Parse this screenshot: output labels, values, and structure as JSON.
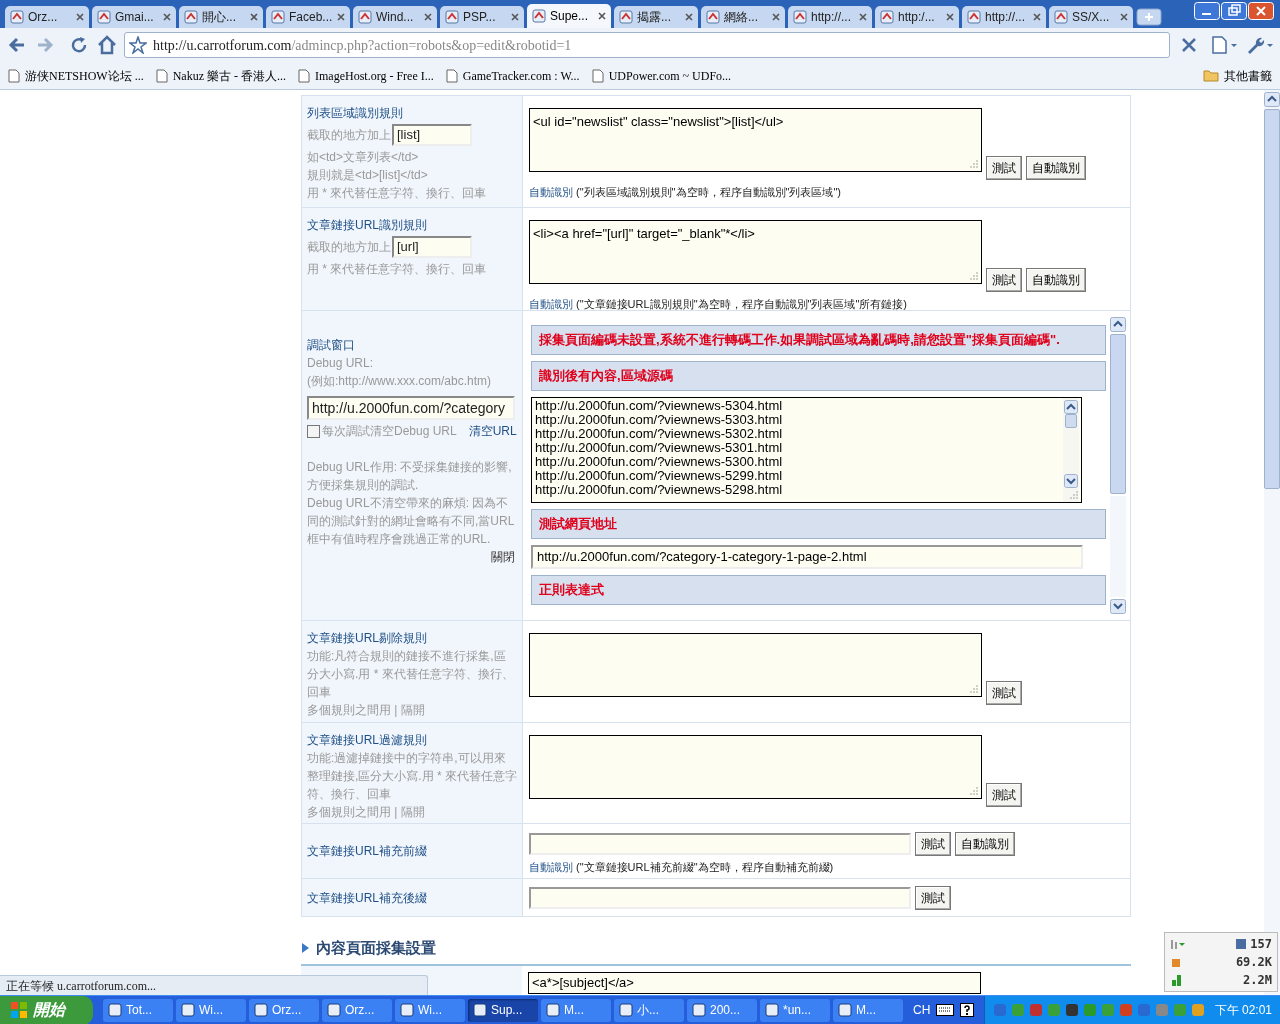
{
  "tabs": [
    {
      "label": "Orz...",
      "selected": false
    },
    {
      "label": "Gmai...",
      "selected": false
    },
    {
      "label": "開心...",
      "selected": false
    },
    {
      "label": "Faceb...",
      "selected": false
    },
    {
      "label": "Wind...",
      "selected": false
    },
    {
      "label": "PSP...",
      "selected": false
    },
    {
      "label": "Supe...",
      "selected": true
    },
    {
      "label": "揭露...",
      "selected": false
    },
    {
      "label": "網絡...",
      "selected": false
    },
    {
      "label": "http://...",
      "selected": false
    },
    {
      "label": "http:/...",
      "selected": false
    },
    {
      "label": "http://...",
      "selected": false
    },
    {
      "label": "SS/X...",
      "selected": false
    }
  ],
  "address": {
    "host": "http://u.carrotforum.com",
    "path": "/admincp.php?action=robots&op=edit&robotid=1"
  },
  "bookmarks": [
    "游侠NETSHOW论坛 ...",
    "Nakuz 樂古 - 香港人...",
    "ImageHost.org - Free I...",
    "GameTracker.com : W...",
    "UDPower.com ~ UDFo..."
  ],
  "other_bookmarks": "其他書籤",
  "rules": [
    {
      "kind": "textarea",
      "title": "列表區域識別規則",
      "capture_label": "截取的地方加上",
      "capture_value": "[list]",
      "hints": [
        "如<td>文章列表</td>",
        "規則就是<td>[list]</td>",
        "用 * 來代替任意字符、換行、回車"
      ],
      "value": "<ul id=\"newslist\" class=\"newslist\">[list]</ul>",
      "buttons": [
        "測試",
        "自動識別"
      ],
      "note_link": "自動識別",
      "note": "(\"列表區域識別規則\"為空時，程序自動識別\"列表區域\")"
    },
    {
      "kind": "textarea",
      "title": "文章鏈接URL識別規則",
      "capture_label": "截取的地方加上",
      "capture_value": "[url]",
      "hints": [
        "用 * 來代替任意字符、換行、回車"
      ],
      "value": "<li><a href=\"[url]\" target=\"_blank\"*</li>",
      "buttons": [
        "測試",
        "自動識別"
      ],
      "note_link": "自動識別",
      "note": "(\"文章鏈接URL識別規則\"為空時，程序自動識別\"列表區域\"所有鏈接)"
    },
    {
      "kind": "debug",
      "title": "調試窗口",
      "hints": [
        "Debug URL:",
        "(例如:http://www.xxx.com/abc.htm)"
      ],
      "debug_url": "http://u.2000fun.com/?category",
      "clear_checkbox": {
        "label": "每次調試清空Debug URL",
        "checked": false
      },
      "clear_link": "清空URL",
      "notes": [
        "Debug URL作用: 不受採集鏈接的影響,方便採集規則的調試.",
        "Debug URL不清空帶來的麻煩: 因為不同的測試針對的網址會略有不同,當URL框中有值時程序會跳過正常的URL."
      ],
      "close_link": "關閉",
      "panel": [
        {
          "kind": "heading",
          "text": "採集頁面編碼未設置,系統不進行轉碼工作.如果調試區域為亂碼時,請您設置\"採集頁面編碼\"."
        },
        {
          "kind": "heading",
          "text": "識別後有內容,區域源碼"
        },
        {
          "kind": "list",
          "lines": [
            "http://u.2000fun.com/?viewnews-5304.html",
            "http://u.2000fun.com/?viewnews-5303.html",
            "http://u.2000fun.com/?viewnews-5302.html",
            "http://u.2000fun.com/?viewnews-5301.html",
            "http://u.2000fun.com/?viewnews-5300.html",
            "http://u.2000fun.com/?viewnews-5299.html",
            "http://u.2000fun.com/?viewnews-5298.html"
          ]
        },
        {
          "kind": "heading",
          "text": "測試網頁地址"
        },
        {
          "kind": "input",
          "text": "http://u.2000fun.com/?category-1-category-1-page-2.html"
        },
        {
          "kind": "heading",
          "text": "正則表達式"
        }
      ]
    },
    {
      "kind": "textarea",
      "title": "文章鏈接URL剔除規則",
      "hints": [
        "功能:凡符合規則的鏈接不進行採集,區分大小寫.用 * 來代替任意字符、換行、回車",
        "多個規則之間用 | 隔開"
      ],
      "buttons": [
        "測試"
      ]
    },
    {
      "kind": "textarea",
      "title": "文章鏈接URL過濾規則",
      "hints": [
        "功能:過濾掉鏈接中的字符串,可以用來整理鏈接,區分大小寫.用 * 來代替任意字符、換行、回車",
        "多個規則之間用 | 隔開"
      ],
      "buttons": [
        "測試"
      ]
    },
    {
      "kind": "input",
      "title": "文章鏈接URL補充前綴",
      "buttons": [
        "測試",
        "自動識別"
      ],
      "note_link": "自動識別",
      "note": "(\"文章鏈接URL補充前綴\"為空時，程序自動補充前綴)"
    },
    {
      "kind": "input",
      "title": "文章鏈接URL補充後綴",
      "buttons": [
        "測試"
      ]
    }
  ],
  "section_title": "內容頁面採集設置",
  "next_row_value": "<a*>[subject]</a>",
  "status": "正在等候 u.carrotforum.com...",
  "net_meter": [
    "157",
    "69.2K",
    "2.2M"
  ],
  "taskbar": {
    "start": "開始",
    "items": [
      {
        "label": "Tot...",
        "selected": false
      },
      {
        "label": "Wi...",
        "selected": false
      },
      {
        "label": "Orz...",
        "selected": false
      },
      {
        "label": "Orz...",
        "selected": false
      },
      {
        "label": "Wi...",
        "selected": false
      },
      {
        "label": "Sup...",
        "selected": true
      },
      {
        "label": "M...",
        "selected": false
      },
      {
        "label": "小...",
        "selected": false
      },
      {
        "label": "200...",
        "selected": false
      },
      {
        "label": "*un...",
        "selected": false
      },
      {
        "label": "M...",
        "selected": false
      }
    ],
    "lang": "CH",
    "clock": "下午 02:01"
  }
}
